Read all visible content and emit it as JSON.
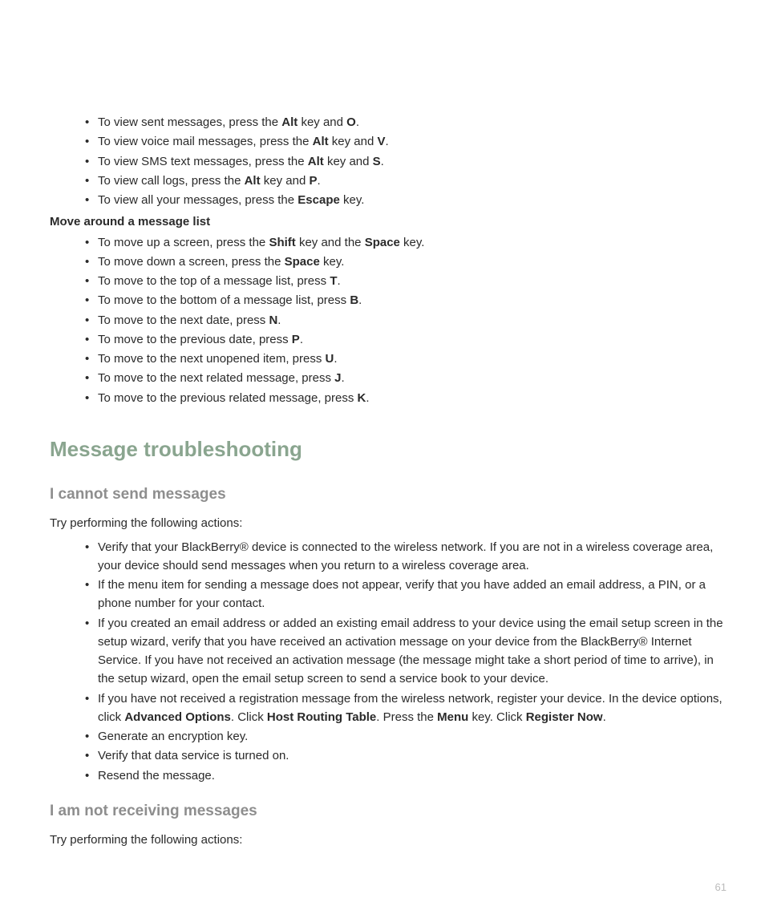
{
  "filterList": {
    "items": [
      {
        "segments": [
          {
            "t": "To view sent messages, press the "
          },
          {
            "t": "Alt",
            "b": true
          },
          {
            "t": " key and "
          },
          {
            "t": "O",
            "b": true
          },
          {
            "t": "."
          }
        ]
      },
      {
        "segments": [
          {
            "t": "To view voice mail messages, press the "
          },
          {
            "t": "Alt",
            "b": true
          },
          {
            "t": " key and "
          },
          {
            "t": "V",
            "b": true
          },
          {
            "t": "."
          }
        ]
      },
      {
        "segments": [
          {
            "t": "To view SMS text messages, press the "
          },
          {
            "t": "Alt",
            "b": true
          },
          {
            "t": " key and "
          },
          {
            "t": "S",
            "b": true
          },
          {
            "t": "."
          }
        ]
      },
      {
        "segments": [
          {
            "t": "To view call logs, press the "
          },
          {
            "t": "Alt",
            "b": true
          },
          {
            "t": " key and "
          },
          {
            "t": "P",
            "b": true
          },
          {
            "t": "."
          }
        ]
      },
      {
        "segments": [
          {
            "t": "To view all your messages, press the "
          },
          {
            "t": "Escape",
            "b": true
          },
          {
            "t": " key."
          }
        ]
      }
    ]
  },
  "moveHeading": "Move around a message list",
  "moveList": {
    "items": [
      {
        "segments": [
          {
            "t": "To move up a screen, press the "
          },
          {
            "t": "Shift",
            "b": true
          },
          {
            "t": " key and the "
          },
          {
            "t": "Space",
            "b": true
          },
          {
            "t": " key."
          }
        ]
      },
      {
        "segments": [
          {
            "t": "To move down a screen, press the "
          },
          {
            "t": "Space",
            "b": true
          },
          {
            "t": " key."
          }
        ]
      },
      {
        "segments": [
          {
            "t": "To move to the top of a message list, press "
          },
          {
            "t": "T",
            "b": true
          },
          {
            "t": "."
          }
        ]
      },
      {
        "segments": [
          {
            "t": "To move to the bottom of a message list, press "
          },
          {
            "t": "B",
            "b": true
          },
          {
            "t": "."
          }
        ]
      },
      {
        "segments": [
          {
            "t": "To move to the next date, press "
          },
          {
            "t": "N",
            "b": true
          },
          {
            "t": "."
          }
        ]
      },
      {
        "segments": [
          {
            "t": "To move to the previous date, press "
          },
          {
            "t": "P",
            "b": true
          },
          {
            "t": "."
          }
        ]
      },
      {
        "segments": [
          {
            "t": "To move to the next unopened item, press "
          },
          {
            "t": "U",
            "b": true
          },
          {
            "t": "."
          }
        ]
      },
      {
        "segments": [
          {
            "t": "To move to the next related message, press "
          },
          {
            "t": "J",
            "b": true
          },
          {
            "t": "."
          }
        ]
      },
      {
        "segments": [
          {
            "t": "To move to the previous related message, press "
          },
          {
            "t": "K",
            "b": true
          },
          {
            "t": "."
          }
        ]
      }
    ]
  },
  "sectionTitle": "Message troubleshooting",
  "topic1": {
    "heading": "I cannot send messages",
    "intro": "Try performing the following actions:",
    "items": [
      {
        "segments": [
          {
            "t": "Verify that your BlackBerry® device is connected to the wireless network. If you are not in a wireless coverage area, your device should send messages when you return to a wireless coverage area."
          }
        ]
      },
      {
        "segments": [
          {
            "t": "If the menu item for sending a message does not appear, verify that you have added an email address, a PIN, or a phone number for your contact."
          }
        ]
      },
      {
        "segments": [
          {
            "t": "If you created an email address or added an existing email address to your device using the email setup screen in the setup wizard, verify that you have received an activation message on your device from the BlackBerry® Internet Service. If you have not received an activation message (the message might take a short period of time to arrive), in the setup wizard, open the email setup screen to send a service book to your device."
          }
        ]
      },
      {
        "segments": [
          {
            "t": "If you have not received a registration message from the wireless network, register your device. In the device options, click "
          },
          {
            "t": "Advanced Options",
            "b": true
          },
          {
            "t": ". Click "
          },
          {
            "t": "Host Routing Table",
            "b": true
          },
          {
            "t": ". Press the "
          },
          {
            "t": "Menu",
            "b": true
          },
          {
            "t": " key. Click "
          },
          {
            "t": "Register Now",
            "b": true
          },
          {
            "t": "."
          }
        ]
      },
      {
        "segments": [
          {
            "t": "Generate an encryption key."
          }
        ]
      },
      {
        "segments": [
          {
            "t": "Verify that data service is turned on."
          }
        ]
      },
      {
        "segments": [
          {
            "t": "Resend the message."
          }
        ]
      }
    ]
  },
  "topic2": {
    "heading": "I am not receiving messages",
    "intro": "Try performing the following actions:"
  },
  "pageNumber": "61"
}
